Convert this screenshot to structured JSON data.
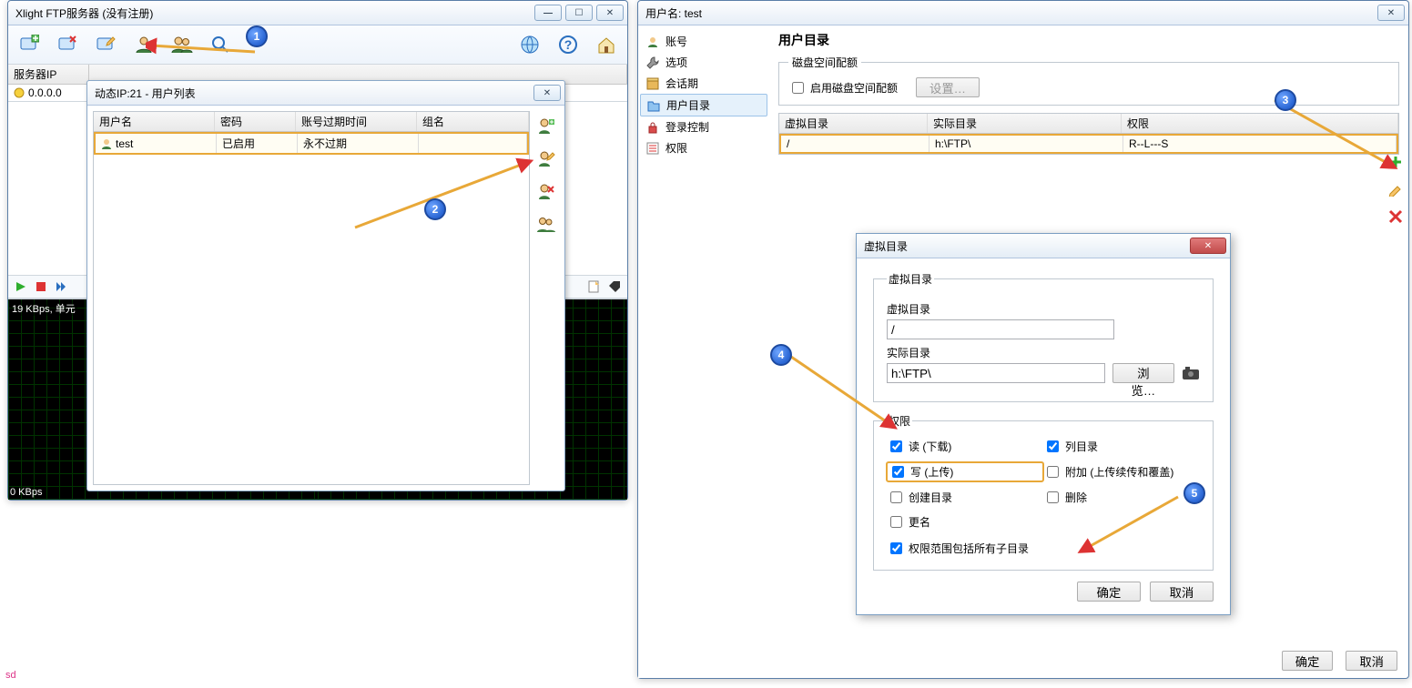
{
  "left_window": {
    "title": "Xlight FTP服务器 (没有注册)",
    "server_header": "服务器IP",
    "server_ip": "0.0.0.0",
    "graph_top_label": "19 KBps, 单元",
    "graph_bottom_label": "0 KBps"
  },
  "userlist_dialog": {
    "title": "动态IP:21 - 用户列表",
    "cols": {
      "user": "用户名",
      "pwd": "密码",
      "expire": "账号过期时间",
      "group": "组名"
    },
    "row": {
      "user": "test",
      "pwd": "已启用",
      "expire": "永不过期",
      "group": ""
    }
  },
  "right_window": {
    "title": "用户名: test",
    "sidebar": {
      "account": "账号",
      "options": "选项",
      "sessions": "会话期",
      "userdir": "用户目录",
      "login": "登录控制",
      "perm": "权限"
    },
    "main_title": "用户目录",
    "quota": {
      "legend": "磁盘空间配额",
      "enable": "启用磁盘空间配额",
      "settings": "设置…"
    },
    "dir_cols": {
      "vpath": "虚拟目录",
      "rpath": "实际目录",
      "perm": "权限"
    },
    "dir_row": {
      "vpath": "/",
      "rpath": "h:\\FTP\\",
      "perm": "R--L---S"
    },
    "ok": "确定",
    "cancel": "取消"
  },
  "vdlg": {
    "title": "虚拟目录",
    "legend": "虚拟目录",
    "vpath_label": "虚拟目录",
    "vpath_value": "/",
    "rpath_label": "实际目录",
    "rpath_value": "h:\\FTP\\",
    "browse": "浏览…",
    "perm_legend": "权限",
    "perm": {
      "read": "读 (下载)",
      "list": "列目录",
      "write": "写 (上传)",
      "append": "附加 (上传续传和覆盖)",
      "mkdir": "创建目录",
      "delete": "删除",
      "rename": "更名",
      "recurse": "权限范围包括所有子目录"
    },
    "ok": "确定",
    "cancel": "取消"
  },
  "bubbles": {
    "1": "1",
    "2": "2",
    "3": "3",
    "4": "4",
    "5": "5"
  },
  "footer": "sd"
}
